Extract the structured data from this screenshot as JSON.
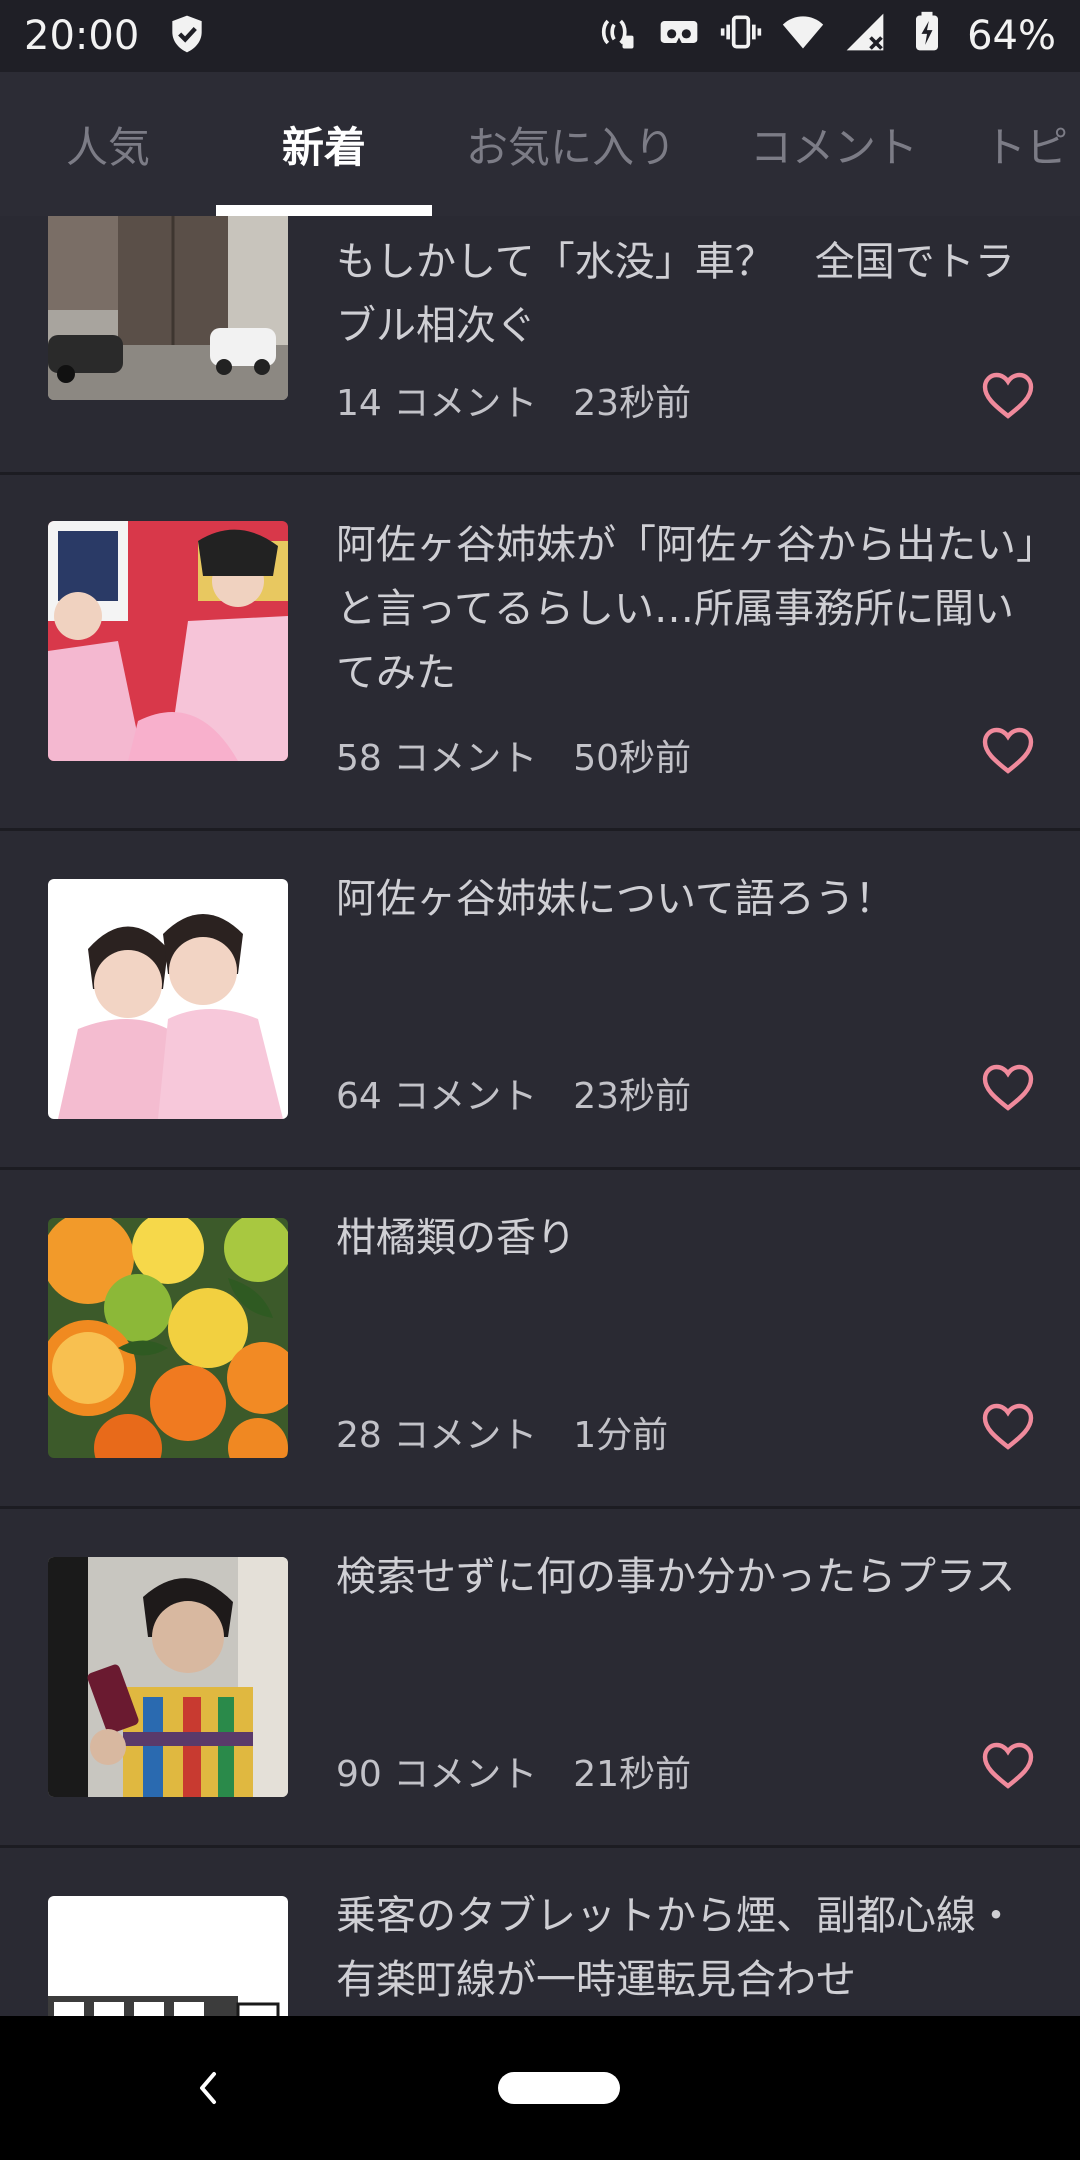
{
  "status_bar": {
    "time": "20:00",
    "battery": "64%",
    "icons": [
      "shield-check-icon",
      "nfc-icon",
      "vr-icon",
      "vibrate-icon",
      "wifi-icon",
      "signal-icon",
      "battery-charging-icon"
    ]
  },
  "tabs": [
    {
      "label": "人気",
      "active": false
    },
    {
      "label": "新着",
      "active": true
    },
    {
      "label": "お気に入り",
      "active": false
    },
    {
      "label": "コメント",
      "active": false
    },
    {
      "label": "トピ",
      "active": false
    }
  ],
  "feed": {
    "items": [
      {
        "title": "もしかして「水没」車？　全国でトラブル相次ぐ",
        "comments": "14 コメント",
        "time": "23秒前",
        "thumb": "car-garage-photo"
      },
      {
        "title": "阿佐ヶ谷姉妹が「阿佐ヶ谷から出たい」と言ってるらしい…所属事務所に聞いてみた",
        "comments": "58 コメント",
        "time": "50秒前",
        "thumb": "two-women-pink-dresses-photo"
      },
      {
        "title": "阿佐ヶ谷姉妹について語ろう！",
        "comments": "64 コメント",
        "time": "23秒前",
        "thumb": "two-women-portrait-photo"
      },
      {
        "title": "柑橘類の香り",
        "comments": "28 コメント",
        "time": "1分前",
        "thumb": "citrus-fruits-photo"
      },
      {
        "title": "検索せずに何の事か分かったらプラス",
        "comments": "90 コメント",
        "time": "21秒前",
        "thumb": "man-with-flip-phone-photo"
      },
      {
        "title": "乗客のタブレットから煙、副都心線・有楽町線が一時運転見合わせ",
        "comments": "",
        "time": "",
        "thumb": "newspaper-logo-photo"
      }
    ]
  },
  "colors": {
    "background": "#2a2a33",
    "heart": "#f08a9c",
    "tab_active": "#ffffff",
    "tab_inactive": "#7c7c86"
  }
}
